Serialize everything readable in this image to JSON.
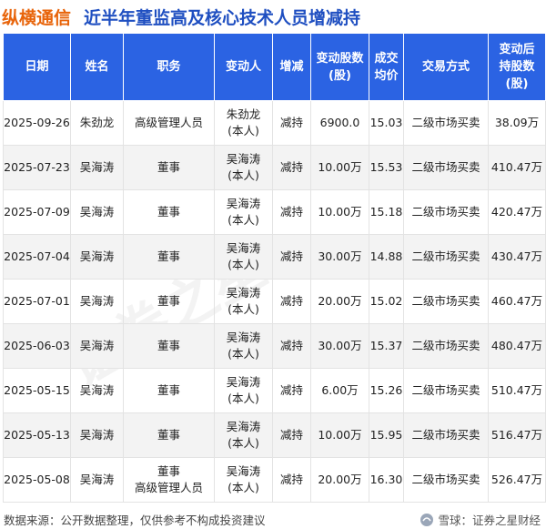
{
  "header": {
    "company": "纵横通信",
    "headline": "近半年董监高及核心技术人员增减持"
  },
  "columns": {
    "date": "日期",
    "name": "姓名",
    "position": "职务",
    "changer": "变动人",
    "direction": "增减",
    "shares": [
      "变动股数",
      "(股)"
    ],
    "avg_price": [
      "成交",
      "均价"
    ],
    "method": "交易方式",
    "after": [
      "变动后",
      "持股数",
      "(股)"
    ]
  },
  "rows": [
    {
      "date": "2025-09-26",
      "name": "朱劲龙",
      "position": [
        "高级管理人员"
      ],
      "changer": [
        "朱劲龙",
        "(本人)"
      ],
      "direction": "减持",
      "shares": "6900.0",
      "avg_price": "15.03",
      "method": "二级市场买卖",
      "after": "38.09万"
    },
    {
      "date": "2025-07-23",
      "name": "吴海涛",
      "position": [
        "董事"
      ],
      "changer": [
        "吴海涛",
        "(本人)"
      ],
      "direction": "减持",
      "shares": "10.00万",
      "avg_price": "15.53",
      "method": "二级市场买卖",
      "after": "410.47万"
    },
    {
      "date": "2025-07-09",
      "name": "吴海涛",
      "position": [
        "董事"
      ],
      "changer": [
        "吴海涛",
        "(本人)"
      ],
      "direction": "减持",
      "shares": "10.00万",
      "avg_price": "15.18",
      "method": "二级市场买卖",
      "after": "420.47万"
    },
    {
      "date": "2025-07-04",
      "name": "吴海涛",
      "position": [
        "董事"
      ],
      "changer": [
        "吴海涛",
        "(本人)"
      ],
      "direction": "减持",
      "shares": "30.00万",
      "avg_price": "14.88",
      "method": "二级市场买卖",
      "after": "430.47万"
    },
    {
      "date": "2025-07-01",
      "name": "吴海涛",
      "position": [
        "董事"
      ],
      "changer": [
        "吴海涛",
        "(本人)"
      ],
      "direction": "减持",
      "shares": "20.00万",
      "avg_price": "15.02",
      "method": "二级市场买卖",
      "after": "460.47万"
    },
    {
      "date": "2025-06-03",
      "name": "吴海涛",
      "position": [
        "董事"
      ],
      "changer": [
        "吴海涛",
        "(本人)"
      ],
      "direction": "减持",
      "shares": "30.00万",
      "avg_price": "15.37",
      "method": "二级市场买卖",
      "after": "480.47万"
    },
    {
      "date": "2025-05-15",
      "name": "吴海涛",
      "position": [
        "董事"
      ],
      "changer": [
        "吴海涛",
        "(本人)"
      ],
      "direction": "减持",
      "shares": "6.00万",
      "avg_price": "15.26",
      "method": "二级市场买卖",
      "after": "510.47万"
    },
    {
      "date": "2025-05-13",
      "name": "吴海涛",
      "position": [
        "董事"
      ],
      "changer": [
        "吴海涛",
        "(本人)"
      ],
      "direction": "减持",
      "shares": "10.00万",
      "avg_price": "15.95",
      "method": "二级市场买卖",
      "after": "516.47万"
    },
    {
      "date": "2025-05-08",
      "name": "吴海涛",
      "position": [
        "董事",
        "高级管理人员"
      ],
      "changer": [
        "吴海涛",
        "(本人)"
      ],
      "direction": "减持",
      "shares": "20.00万",
      "avg_price": "16.30",
      "method": "二级市场买卖",
      "after": "526.47万"
    }
  ],
  "footer": {
    "source": "数据来源：公开数据整理，仅供参考不构成投资建议",
    "brand": "雪球：证券之星财经",
    "brand_icon": "snowball-icon"
  },
  "watermark": "证券之星",
  "colors": {
    "header_bg": "#2b63e3",
    "company": "#e8640a",
    "headline": "#1f4fc1",
    "reduce": "#1aa51a"
  }
}
